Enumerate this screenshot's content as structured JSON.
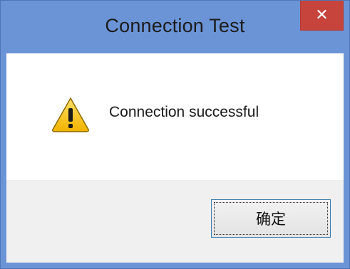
{
  "window": {
    "title": "Connection Test",
    "close_glyph": "✕"
  },
  "dialog": {
    "icon": "warning-icon",
    "message": "Connection successful",
    "ok_label": "确定"
  },
  "colors": {
    "titlebar": "#6b94d6",
    "close_button": "#c6443b",
    "content_bg": "#ffffff",
    "footer_bg": "#f0f0f0",
    "warning_yellow": "#f5c400"
  }
}
